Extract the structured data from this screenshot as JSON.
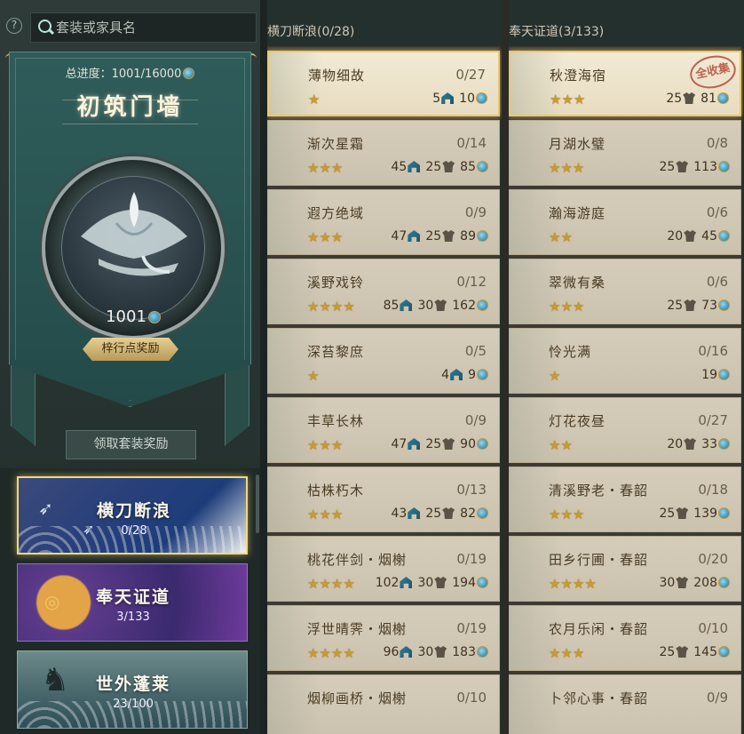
{
  "search": {
    "placeholder": "套装或家具名"
  },
  "help": "?",
  "summary": {
    "total_progress": "总进度：1001/16000",
    "wall_title": "初筑门墙",
    "medal_value": "1001",
    "reward_button": "梓行点奖励",
    "claim_button": "领取套装奖励"
  },
  "series": [
    {
      "name": "横刀断浪",
      "count": "0/28"
    },
    {
      "name": "奉天证道",
      "count": "3/133"
    },
    {
      "name": "世外蓬莱",
      "count": "23/100"
    }
  ],
  "columns": [
    {
      "header": "横刀断浪(0/28)"
    },
    {
      "header": "奉天证道(3/133)"
    }
  ],
  "stamp": "全收集",
  "col1": [
    {
      "name": "薄物细故",
      "progress": "0/27",
      "stars": "★",
      "furniture": "5",
      "outfit": "",
      "coins": "10"
    },
    {
      "name": "渐次星霜",
      "progress": "0/14",
      "stars": "★★★",
      "furniture": "45",
      "outfit": "25",
      "coins": "85"
    },
    {
      "name": "遐方绝域",
      "progress": "0/9",
      "stars": "★★★",
      "furniture": "47",
      "outfit": "25",
      "coins": "89"
    },
    {
      "name": "溪野戏铃",
      "progress": "0/12",
      "stars": "★★★★",
      "furniture": "85",
      "outfit": "30",
      "coins": "162"
    },
    {
      "name": "深苔黎庶",
      "progress": "0/5",
      "stars": "★",
      "furniture": "4",
      "outfit": "",
      "coins": "9"
    },
    {
      "name": "丰草长林",
      "progress": "0/9",
      "stars": "★★★",
      "furniture": "47",
      "outfit": "25",
      "coins": "90"
    },
    {
      "name": "枯株朽木",
      "progress": "0/13",
      "stars": "★★★",
      "furniture": "43",
      "outfit": "25",
      "coins": "82"
    },
    {
      "name": "桃花伴剑・烟榭",
      "progress": "0/19",
      "stars": "★★★★",
      "furniture": "102",
      "outfit": "30",
      "coins": "194"
    },
    {
      "name": "浮世晴霁・烟榭",
      "progress": "0/19",
      "stars": "★★★★",
      "furniture": "96",
      "outfit": "30",
      "coins": "183"
    },
    {
      "name": "烟柳画桥・烟榭",
      "progress": "0/10",
      "stars": "",
      "furniture": "",
      "outfit": "",
      "coins": ""
    }
  ],
  "col2": [
    {
      "name": "秋澄海宿",
      "progress": "",
      "stars": "★★★",
      "furniture": "",
      "outfit": "25",
      "coins": "81"
    },
    {
      "name": "月湖水璧",
      "progress": "0/8",
      "stars": "★★★",
      "furniture": "",
      "outfit": "25",
      "coins": "113"
    },
    {
      "name": "瀚海游庭",
      "progress": "0/6",
      "stars": "★★",
      "furniture": "",
      "outfit": "20",
      "coins": "45"
    },
    {
      "name": "翠微有桑",
      "progress": "0/6",
      "stars": "★★★",
      "furniture": "",
      "outfit": "25",
      "coins": "73"
    },
    {
      "name": "怜光满",
      "progress": "0/16",
      "stars": "★",
      "furniture": "",
      "outfit": "",
      "coins": "19"
    },
    {
      "name": "灯花夜昼",
      "progress": "0/27",
      "stars": "★★",
      "furniture": "",
      "outfit": "20",
      "coins": "33"
    },
    {
      "name": "清溪野老・春韶",
      "progress": "0/18",
      "stars": "★★★",
      "furniture": "",
      "outfit": "25",
      "coins": "139"
    },
    {
      "name": "田乡行圃・春韶",
      "progress": "0/20",
      "stars": "★★★★",
      "furniture": "",
      "outfit": "30",
      "coins": "208"
    },
    {
      "name": "农月乐闲・春韶",
      "progress": "0/10",
      "stars": "★★★",
      "furniture": "",
      "outfit": "25",
      "coins": "145"
    },
    {
      "name": "卜邻心事・春韶",
      "progress": "0/9",
      "stars": "",
      "furniture": "",
      "outfit": "",
      "coins": ""
    }
  ]
}
